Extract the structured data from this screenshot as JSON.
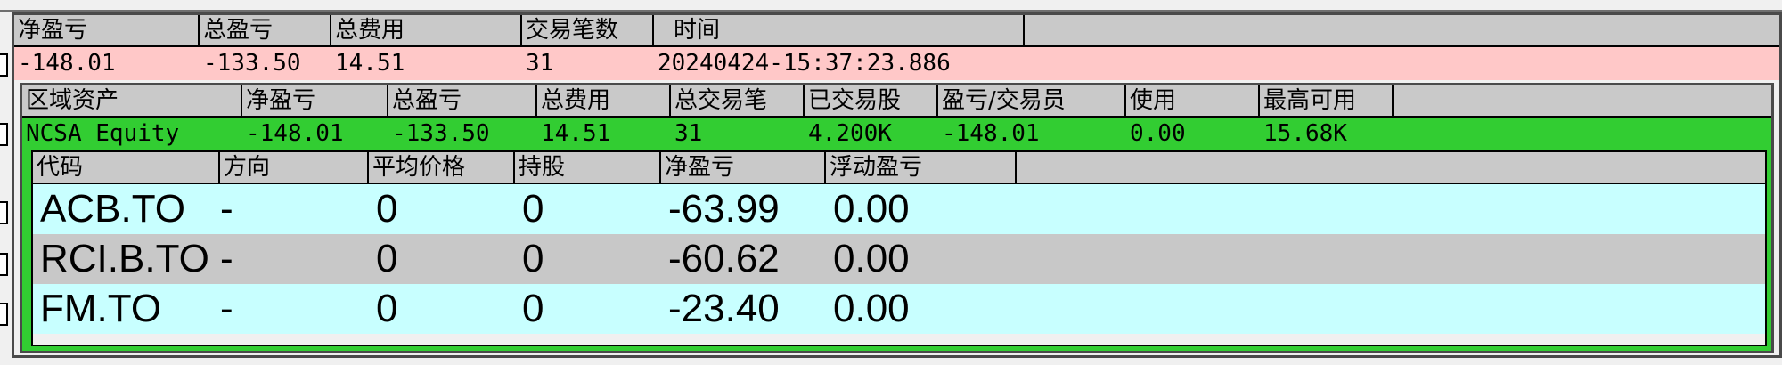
{
  "summary": {
    "headers": [
      "净盈亏",
      "总盈亏",
      "总费用",
      "交易笔数",
      "时间"
    ],
    "row": [
      "-148.01",
      "-133.50",
      "14.51",
      "31",
      "20240424-15:37:23.886"
    ]
  },
  "region": {
    "headers": [
      "区域资产",
      "净盈亏",
      "总盈亏",
      "总费用",
      "总交易笔",
      "已交易股",
      "盈亏/交易员",
      "使用",
      "最高可用"
    ],
    "row": [
      "NCSA Equity",
      "-148.01",
      "-133.50",
      "14.51",
      "31",
      "4.200K",
      "-148.01",
      "0.00",
      "15.68K"
    ]
  },
  "positions": {
    "headers": [
      "代码",
      "方向",
      "平均价格",
      "持股",
      "净盈亏",
      "浮动盈亏"
    ],
    "rows": [
      [
        "ACB.TO",
        "-",
        "0",
        "0",
        "-63.99",
        "0.00"
      ],
      [
        "RCI.B.TO",
        "-",
        "0",
        "0",
        "-60.62",
        "0.00"
      ],
      [
        "FM.TO",
        "-",
        "0",
        "0",
        "-23.40",
        "0.00"
      ]
    ]
  },
  "colors": {
    "summary_row_bg": "#ffc8c8",
    "region_row_bg": "#32cd32",
    "position_row_cyan": "#c8ffff",
    "position_row_gray": "#c8c8c8",
    "header_bg": "#c9c9c9"
  }
}
